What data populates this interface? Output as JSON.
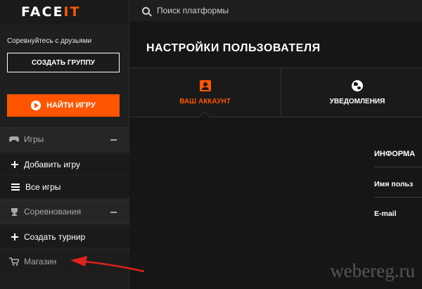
{
  "logo": {
    "text_a": "FACE",
    "text_b": "IT"
  },
  "search": {
    "placeholder": "Поиск платформы"
  },
  "sidebar": {
    "compete_text": "Соревнуйтесь с друзьями",
    "create_group_label": "СОЗДАТЬ ГРУППУ",
    "find_game_label": "НАЙТИ ИГРУ",
    "games_section": "Игры",
    "add_game": "Добавить игру",
    "all_games": "Все игры",
    "competitions_section": "Соревнования",
    "create_tournament": "Создать турнир",
    "shop": "Магазин"
  },
  "main": {
    "title": "НАСТРОЙКИ ПОЛЬЗОВАТЕЛЯ",
    "tabs": [
      {
        "label": "ВАШ АККАУНТ",
        "icon": "user-icon"
      },
      {
        "label": "УВЕДОМЛЕНИЯ",
        "icon": "globe-icon"
      }
    ],
    "info_header": "ИНФОРМА",
    "username_label": "Имя польз",
    "email_label": "E-mail"
  },
  "watermark": "webereg.ru",
  "colors": {
    "accent": "#ff5500",
    "arrow": "#e0221c"
  }
}
